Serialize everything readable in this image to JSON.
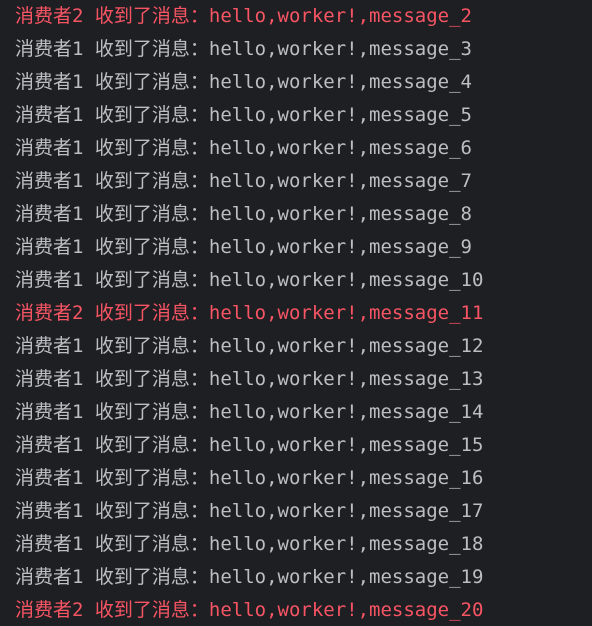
{
  "console": {
    "lines": [
      {
        "label": "消费者2 收到了消息：",
        "message": "hello,worker!,message_2",
        "stream": "stderr"
      },
      {
        "label": "消费者1 收到了消息：",
        "message": "hello,worker!,message_3",
        "stream": "stdout"
      },
      {
        "label": "消费者1 收到了消息：",
        "message": "hello,worker!,message_4",
        "stream": "stdout"
      },
      {
        "label": "消费者1 收到了消息：",
        "message": "hello,worker!,message_5",
        "stream": "stdout"
      },
      {
        "label": "消费者1 收到了消息：",
        "message": "hello,worker!,message_6",
        "stream": "stdout"
      },
      {
        "label": "消费者1 收到了消息：",
        "message": "hello,worker!,message_7",
        "stream": "stdout"
      },
      {
        "label": "消费者1 收到了消息：",
        "message": "hello,worker!,message_8",
        "stream": "stdout"
      },
      {
        "label": "消费者1 收到了消息：",
        "message": "hello,worker!,message_9",
        "stream": "stdout"
      },
      {
        "label": "消费者1 收到了消息：",
        "message": "hello,worker!,message_10",
        "stream": "stdout"
      },
      {
        "label": "消费者2 收到了消息：",
        "message": "hello,worker!,message_11",
        "stream": "stderr"
      },
      {
        "label": "消费者1 收到了消息：",
        "message": "hello,worker!,message_12",
        "stream": "stdout"
      },
      {
        "label": "消费者1 收到了消息：",
        "message": "hello,worker!,message_13",
        "stream": "stdout"
      },
      {
        "label": "消费者1 收到了消息：",
        "message": "hello,worker!,message_14",
        "stream": "stdout"
      },
      {
        "label": "消费者1 收到了消息：",
        "message": "hello,worker!,message_15",
        "stream": "stdout"
      },
      {
        "label": "消费者1 收到了消息：",
        "message": "hello,worker!,message_16",
        "stream": "stdout"
      },
      {
        "label": "消费者1 收到了消息：",
        "message": "hello,worker!,message_17",
        "stream": "stdout"
      },
      {
        "label": "消费者1 收到了消息：",
        "message": "hello,worker!,message_18",
        "stream": "stdout"
      },
      {
        "label": "消费者1 收到了消息：",
        "message": "hello,worker!,message_19",
        "stream": "stdout"
      },
      {
        "label": "消费者2 收到了消息：",
        "message": "hello,worker!,message_20",
        "stream": "stderr"
      }
    ],
    "colors": {
      "background": "#1e1f22",
      "stdout": "#bcbec4",
      "stderr": "#f75464"
    }
  }
}
